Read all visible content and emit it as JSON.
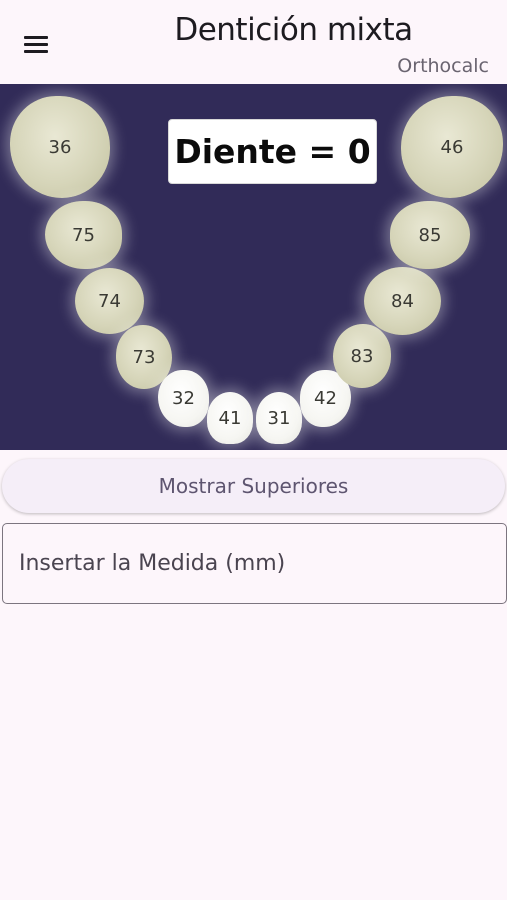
{
  "app_bar": {
    "title": "Dentición mixta",
    "subtitle": "Orthocalc",
    "menu_icon": "menu-icon"
  },
  "arch": {
    "readout": "Diente = 0",
    "teeth": [
      "36",
      "75",
      "74",
      "73",
      "32",
      "41",
      "31",
      "42",
      "83",
      "84",
      "85",
      "46"
    ]
  },
  "actions": {
    "toggle_label": "Mostrar Superiores"
  },
  "measure": {
    "placeholder": "Insertar la Medida (mm)",
    "value": ""
  },
  "colors": {
    "background": "#fdf6fb",
    "arch_panel": "#312b58",
    "molar": "#d6d5b9",
    "incisor": "#f6f6f2"
  }
}
